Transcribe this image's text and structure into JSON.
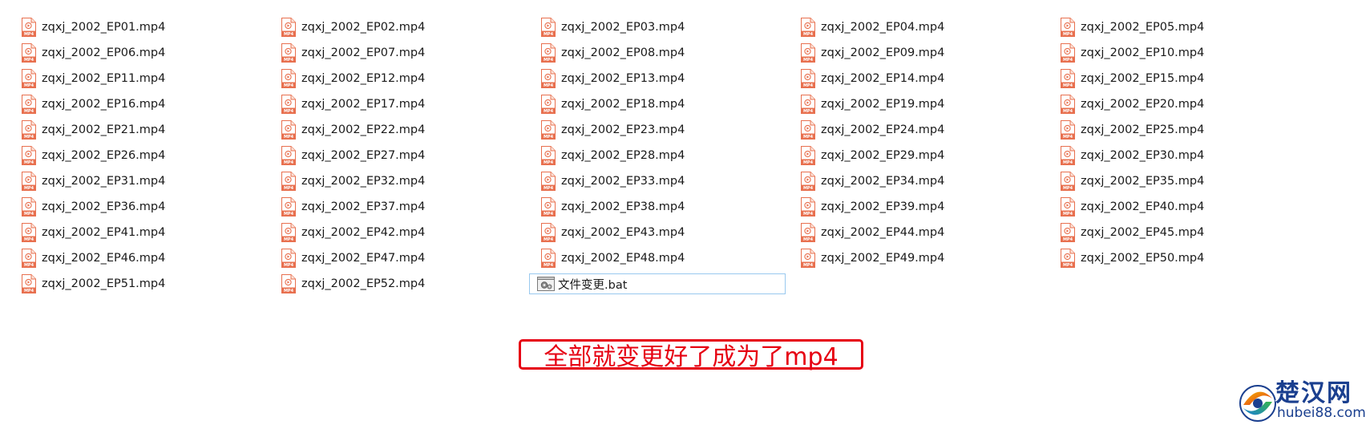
{
  "files": [
    {
      "name": "zqxj_2002_EP01.mp4",
      "type": "mp4"
    },
    {
      "name": "zqxj_2002_EP02.mp4",
      "type": "mp4"
    },
    {
      "name": "zqxj_2002_EP03.mp4",
      "type": "mp4"
    },
    {
      "name": "zqxj_2002_EP04.mp4",
      "type": "mp4"
    },
    {
      "name": "zqxj_2002_EP05.mp4",
      "type": "mp4"
    },
    {
      "name": "zqxj_2002_EP06.mp4",
      "type": "mp4"
    },
    {
      "name": "zqxj_2002_EP07.mp4",
      "type": "mp4"
    },
    {
      "name": "zqxj_2002_EP08.mp4",
      "type": "mp4"
    },
    {
      "name": "zqxj_2002_EP09.mp4",
      "type": "mp4"
    },
    {
      "name": "zqxj_2002_EP10.mp4",
      "type": "mp4"
    },
    {
      "name": "zqxj_2002_EP11.mp4",
      "type": "mp4"
    },
    {
      "name": "zqxj_2002_EP12.mp4",
      "type": "mp4"
    },
    {
      "name": "zqxj_2002_EP13.mp4",
      "type": "mp4"
    },
    {
      "name": "zqxj_2002_EP14.mp4",
      "type": "mp4"
    },
    {
      "name": "zqxj_2002_EP15.mp4",
      "type": "mp4"
    },
    {
      "name": "zqxj_2002_EP16.mp4",
      "type": "mp4"
    },
    {
      "name": "zqxj_2002_EP17.mp4",
      "type": "mp4"
    },
    {
      "name": "zqxj_2002_EP18.mp4",
      "type": "mp4"
    },
    {
      "name": "zqxj_2002_EP19.mp4",
      "type": "mp4"
    },
    {
      "name": "zqxj_2002_EP20.mp4",
      "type": "mp4"
    },
    {
      "name": "zqxj_2002_EP21.mp4",
      "type": "mp4"
    },
    {
      "name": "zqxj_2002_EP22.mp4",
      "type": "mp4"
    },
    {
      "name": "zqxj_2002_EP23.mp4",
      "type": "mp4"
    },
    {
      "name": "zqxj_2002_EP24.mp4",
      "type": "mp4"
    },
    {
      "name": "zqxj_2002_EP25.mp4",
      "type": "mp4"
    },
    {
      "name": "zqxj_2002_EP26.mp4",
      "type": "mp4"
    },
    {
      "name": "zqxj_2002_EP27.mp4",
      "type": "mp4"
    },
    {
      "name": "zqxj_2002_EP28.mp4",
      "type": "mp4"
    },
    {
      "name": "zqxj_2002_EP29.mp4",
      "type": "mp4"
    },
    {
      "name": "zqxj_2002_EP30.mp4",
      "type": "mp4"
    },
    {
      "name": "zqxj_2002_EP31.mp4",
      "type": "mp4"
    },
    {
      "name": "zqxj_2002_EP32.mp4",
      "type": "mp4"
    },
    {
      "name": "zqxj_2002_EP33.mp4",
      "type": "mp4"
    },
    {
      "name": "zqxj_2002_EP34.mp4",
      "type": "mp4"
    },
    {
      "name": "zqxj_2002_EP35.mp4",
      "type": "mp4"
    },
    {
      "name": "zqxj_2002_EP36.mp4",
      "type": "mp4"
    },
    {
      "name": "zqxj_2002_EP37.mp4",
      "type": "mp4"
    },
    {
      "name": "zqxj_2002_EP38.mp4",
      "type": "mp4"
    },
    {
      "name": "zqxj_2002_EP39.mp4",
      "type": "mp4"
    },
    {
      "name": "zqxj_2002_EP40.mp4",
      "type": "mp4"
    },
    {
      "name": "zqxj_2002_EP41.mp4",
      "type": "mp4"
    },
    {
      "name": "zqxj_2002_EP42.mp4",
      "type": "mp4"
    },
    {
      "name": "zqxj_2002_EP43.mp4",
      "type": "mp4"
    },
    {
      "name": "zqxj_2002_EP44.mp4",
      "type": "mp4"
    },
    {
      "name": "zqxj_2002_EP45.mp4",
      "type": "mp4"
    },
    {
      "name": "zqxj_2002_EP46.mp4",
      "type": "mp4"
    },
    {
      "name": "zqxj_2002_EP47.mp4",
      "type": "mp4"
    },
    {
      "name": "zqxj_2002_EP48.mp4",
      "type": "mp4"
    },
    {
      "name": "zqxj_2002_EP49.mp4",
      "type": "mp4"
    },
    {
      "name": "zqxj_2002_EP50.mp4",
      "type": "mp4"
    },
    {
      "name": "zqxj_2002_EP51.mp4",
      "type": "mp4"
    },
    {
      "name": "zqxj_2002_EP52.mp4",
      "type": "mp4"
    },
    {
      "name": "文件变更.bat",
      "type": "bat",
      "selected": true
    }
  ],
  "icons": {
    "mp4": "mp4-file-icon",
    "bat": "batch-file-gear-icon",
    "mp4_badge": "MP4",
    "mp4_color": "#e8704f"
  },
  "annotation": {
    "text": "全部就变更好了成为了mp4",
    "color": "#e60012"
  },
  "watermark": {
    "name": "楚汉网",
    "domain": "hubei88.com",
    "color": "#1a3f8f"
  },
  "colors": {
    "selection_border": "#99c9ef",
    "background": "#ffffff"
  }
}
